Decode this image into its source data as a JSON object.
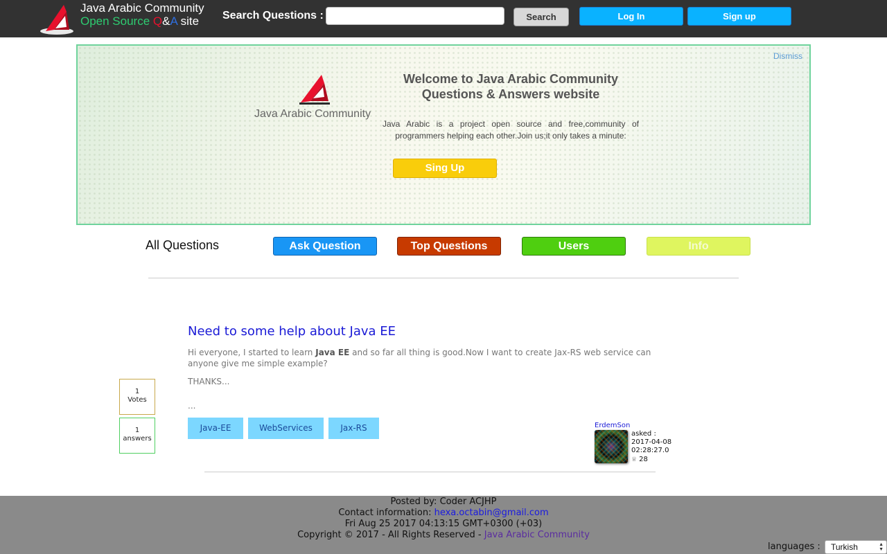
{
  "header": {
    "site_title_line1": "Java Arabic Community",
    "site_title_line2_prefix": "Open Source ",
    "site_title_q": "Q",
    "site_title_amp": "&",
    "site_title_a": "A",
    "site_title_suffix": " site",
    "search_label": "Search Questions :",
    "search_value": "",
    "search_button": "Search",
    "login_button": "Log In",
    "signup_button": "Sign up",
    "colors": {
      "bar": "#323232",
      "accent_green": "#2ecc71",
      "accent_blue": "#0ab2ff"
    }
  },
  "banner": {
    "dismiss": "Dismiss",
    "logo_text": "Java Arabic Community",
    "title_line1": "Welcome to Java Arabic Community",
    "title_line2": "Questions & Answers website",
    "description": "Java Arabic is a project open source and free,community of programmers helping each other.Join us;it only takes a minute:",
    "signup_button": "Sing Up"
  },
  "nav": {
    "heading": "All Questions",
    "ask": "Ask Question",
    "top": "Top Questions",
    "users": "Users",
    "info": "Info"
  },
  "question": {
    "title": "Need to some help about Java EE",
    "body_before": "Hi everyone, I started to learn ",
    "body_bold": "Java EE",
    "body_after": " and so far all thing is good.Now I want to create Jax-RS web service can anyone give me simple example?",
    "thanks": "THANKS...",
    "ellipsis": "...",
    "votes_count": "1",
    "votes_label": "Votes",
    "answers_count": "1",
    "answers_label": "answers",
    "tags": [
      "Java-EE",
      "WebServices",
      "Jax-RS"
    ],
    "author": "ErdemSon",
    "asked_label": "asked :",
    "asked_date": "2017-04-08",
    "asked_time": "02:28:27.0",
    "reputation": "28"
  },
  "footer": {
    "posted_by": "Posted by: Coder ACJHP",
    "contact_label": "Contact information: ",
    "contact_email": "hexa.octabin@gmail.com",
    "datetime": "Fri Aug 25 2017 04:13:15 GMT+0300 (+03)",
    "copyright_prefix": "Copyright © 2017 - All Rights Reserved - ",
    "copyright_link": "Java Arabic Community",
    "languages_label": "languages :",
    "language_selected": "Turkish"
  }
}
